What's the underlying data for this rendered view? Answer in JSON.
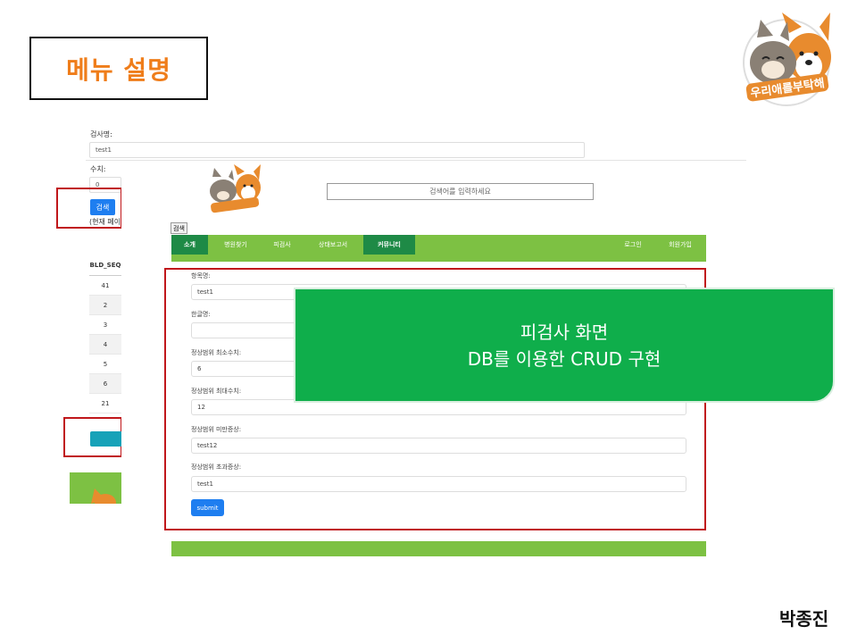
{
  "slide": {
    "title": "메뉴 설명",
    "author": "박종진",
    "brand_logo_text": "우리애를부탁해"
  },
  "callout": {
    "line1": "피검사 화면",
    "line2": "DB를 이용한 CRUD 구현"
  },
  "background_page": {
    "field1_label": "검사명:",
    "field1_value": "test1",
    "field2_label": "수치:",
    "field2_value": "0",
    "search_button": "검색",
    "page_note": "(현재 페이",
    "table_header": "BLD_SEQ",
    "table_rows": [
      "41",
      "2",
      "3",
      "4",
      "5",
      "6",
      "21"
    ]
  },
  "app": {
    "search_placeholder": "검색어를 입력하세요",
    "search_button": "검색",
    "nav": {
      "items": [
        "소개",
        "병원찾기",
        "피검사",
        "상태보고서",
        "커뮤니티"
      ],
      "active": "소개",
      "highlight": "커뮤니티",
      "login": "로그인",
      "signup": "회원가입"
    },
    "form": {
      "fields": [
        {
          "label": "항목명:",
          "value": "test1"
        },
        {
          "label": "한글명:",
          "value": ""
        },
        {
          "label": "정상범위 최소수치:",
          "value": "6"
        },
        {
          "label": "정상범위 최대수치:",
          "value": "12"
        },
        {
          "label": "정상범위 미만증상:",
          "value": "test12"
        },
        {
          "label": "정상범위 초과증상:",
          "value": "test1"
        }
      ],
      "submit": "submit"
    }
  },
  "colors": {
    "accent_orange": "#ef7d1a",
    "nav_green": "#7dc143",
    "nav_active": "#1e8a46",
    "callout_green": "#0fae4b",
    "frame_red": "#c0171b",
    "button_blue": "#1e7ef0"
  }
}
